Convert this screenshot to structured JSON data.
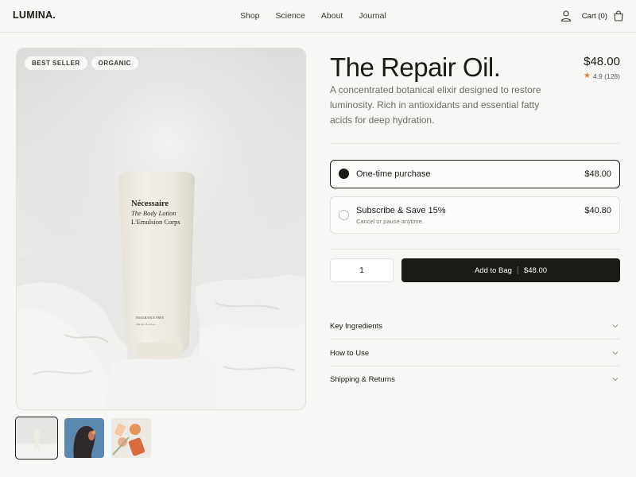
{
  "header": {
    "logo": "LUMINA.",
    "nav": [
      "Shop",
      "Science",
      "About",
      "Journal"
    ],
    "cart_label": "Cart (0)",
    "icons": [
      "user-icon",
      "shopping-bag-icon"
    ]
  },
  "gallery": {
    "badges": [
      "BEST SELLER",
      "ORGANIC"
    ],
    "thumbnails": [
      "thumbnail-lotion",
      "thumbnail-portrait",
      "thumbnail-citrus"
    ],
    "product_label": {
      "brand": "Nécessaire",
      "line1": "The Body Lotion",
      "line2": "L'Emulsion Corps",
      "note": "FRAGRANCE FREE",
      "volume": "250 ml / 8.4 fl oz"
    }
  },
  "product": {
    "title": "The Repair Oil.",
    "price": "$48.00",
    "rating": "4.9 (128)",
    "description": "A concentrated botanical elixir designed to restore luminosity. Rich in antioxidants and essential fatty acids for deep hydration."
  },
  "purchase_options": [
    {
      "label": "One-time purchase",
      "price": "$48.00",
      "selected": true
    },
    {
      "label": "Subscribe & Save 15%",
      "sub": "Cancel or pause anytime.",
      "price": "$40.80",
      "selected": false
    }
  ],
  "cart": {
    "quantity": "1",
    "button_label": "Add to Bag",
    "button_price": "$48.00"
  },
  "accordion": [
    "Key Ingredients",
    "How to Use",
    "Shipping & Returns"
  ],
  "colors": {
    "background": "#f7f7f5",
    "text": "#1c1a17",
    "accent_star": "#e07a3a",
    "button": "#1c1a17"
  }
}
